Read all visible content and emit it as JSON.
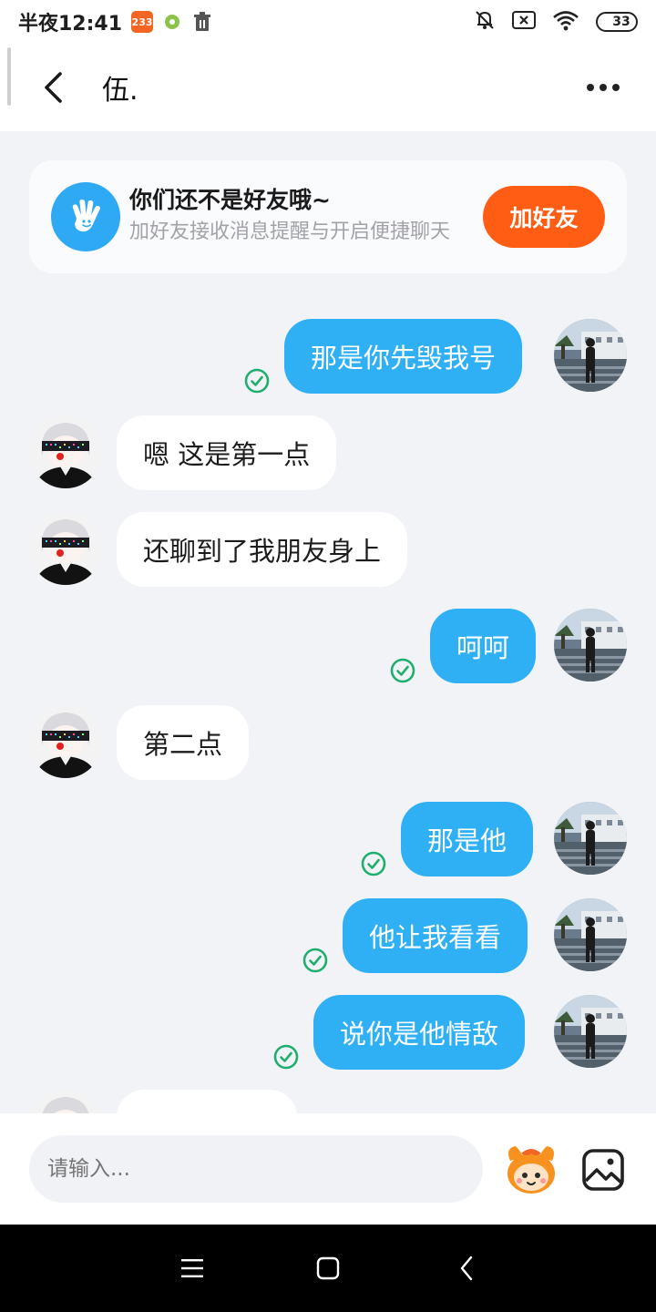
{
  "status_bar": {
    "time": "半夜12:41",
    "app_badge": "233",
    "battery": "33"
  },
  "header": {
    "title": "伍."
  },
  "friend_prompt": {
    "title": "你们还不是好友哦~",
    "subtitle": "加好友接收消息提醒与开启便捷聊天",
    "button_label": "加好友"
  },
  "messages": [
    {
      "side": "sent",
      "text": "那是你先毁我号",
      "status": "read"
    },
    {
      "side": "received",
      "text": "嗯 这是第一点"
    },
    {
      "side": "received",
      "text": "还聊到了我朋友身上"
    },
    {
      "side": "sent",
      "text": "呵呵",
      "status": "read"
    },
    {
      "side": "received",
      "text": "第二点"
    },
    {
      "side": "sent",
      "text": "那是他",
      "status": "read"
    },
    {
      "side": "sent",
      "text": "他让我看看",
      "status": "read"
    },
    {
      "side": "sent",
      "text": "说你是他情敌",
      "status": "read"
    },
    {
      "side": "received",
      "text": ""
    }
  ],
  "input": {
    "placeholder": "请输入..."
  },
  "colors": {
    "sent_bubble": "#2fb0f5",
    "add_friend_button": "#ff5c14",
    "read_check": "#1fae6e"
  },
  "icons": {
    "back": "chevron-left-icon",
    "more": "more-dots-icon",
    "emoji": "mascot-emoji-icon",
    "image": "image-icon",
    "read": "check-circle-icon"
  }
}
